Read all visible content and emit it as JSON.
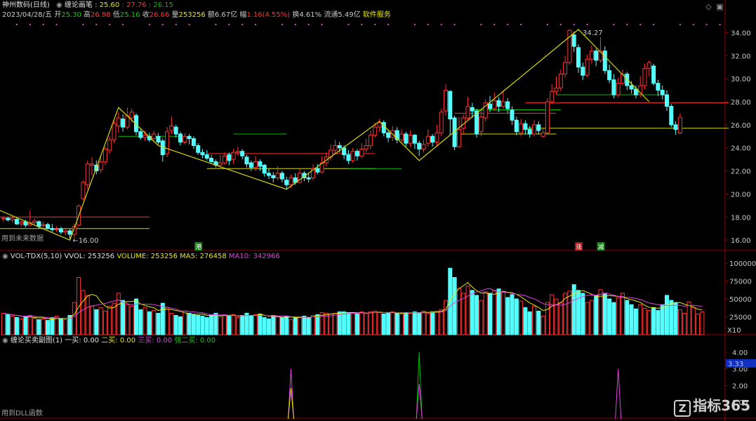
{
  "header": {
    "stock_name": "神州数码(日线)",
    "indicator_name": "缠论画笔",
    "indicator_value": ": 25.60",
    "date": "2023/04/28/五",
    "open_label": "开",
    "open": "25.30",
    "high_label": "高",
    "high": "26.98",
    "low_label": "低",
    "low": "25.16",
    "close_label": "收",
    "close": "26.66",
    "volume_label": "量",
    "volume": "253256",
    "amount_label": "额",
    "amount": "6.67亿",
    "change_label": "幅",
    "change": "1.16(4.55%)",
    "turnover_label": "换",
    "turnover": "4.61%",
    "float_label": "流通",
    "float": "5.49亿",
    "service": "软件服务",
    "extra_vals": [
      ": 27.76",
      ": 26.15"
    ]
  },
  "main_panel": {
    "no_future_text": "用到未来数据",
    "low_annot": "16.00",
    "high_annot": "34.27",
    "markers": [
      "港",
      "涨",
      "减"
    ]
  },
  "vol_panel": {
    "title": "VOL-TDX(5,10)",
    "vvol": "VVOL: 253256",
    "volume": "VOLUME: 253256",
    "ma5": "MA5: 276458",
    "ma10": "MA10: 342966",
    "unit": "X10"
  },
  "sig_panel": {
    "title": "缠论买卖副图(1)",
    "b1": "一买: 0.00",
    "b2": "二买: 0.00",
    "b3": "三买: 0.00",
    "b2s": "强二买: 0.00",
    "dll_text": "用到DLL函数",
    "current": "3.33"
  },
  "watermark": {
    "icon": "Z",
    "text": "指标365"
  },
  "colors": {
    "up": "#ff3232",
    "down": "#54ffff",
    "ma5": "#e8e800",
    "ma10": "#e040e0",
    "bi_line": "#d8d800",
    "green": "#00c000",
    "grid_red": "#8b0000"
  },
  "chart_data": [
    {
      "type": "candlestick",
      "title": "神州数码(日线)",
      "y_ticks": [
        "34.00",
        "32.00",
        "30.00",
        "28.00",
        "26.00",
        "24.00",
        "22.00",
        "20.00",
        "18.00",
        "16.00"
      ],
      "ylim": [
        15.4,
        35.0
      ],
      "candles": [
        [
          17.85,
          17.9,
          18.05,
          17.6
        ],
        [
          17.9,
          17.75,
          18.0,
          17.6
        ],
        [
          17.75,
          17.9,
          18.1,
          17.5
        ],
        [
          17.8,
          17.4,
          17.95,
          17.3
        ],
        [
          17.4,
          17.55,
          17.7,
          17.2
        ],
        [
          17.6,
          17.3,
          17.75,
          17.1
        ],
        [
          17.3,
          17.5,
          18.55,
          17.2
        ],
        [
          17.5,
          17.65,
          17.9,
          17.3
        ],
        [
          17.6,
          17.2,
          17.7,
          17.0
        ],
        [
          17.25,
          17.35,
          17.6,
          17.05
        ],
        [
          17.35,
          17.0,
          17.5,
          16.9
        ],
        [
          17.0,
          16.9,
          17.4,
          16.7
        ],
        [
          16.9,
          16.95,
          17.2,
          16.7
        ],
        [
          16.95,
          16.7,
          17.15,
          16.5
        ],
        [
          16.7,
          16.8,
          17.0,
          16.4
        ],
        [
          16.8,
          16.5,
          16.95,
          16.1
        ],
        [
          16.5,
          17.2,
          17.4,
          16.1
        ],
        [
          17.3,
          18.95,
          19.1,
          17.2
        ],
        [
          19.6,
          21.0,
          21.2,
          19.4
        ],
        [
          20.8,
          22.6,
          22.9,
          20.4
        ],
        [
          22.5,
          22.6,
          23.2,
          21.6
        ],
        [
          22.5,
          22.0,
          22.9,
          21.7
        ],
        [
          22.1,
          22.8,
          23.3,
          21.8
        ],
        [
          22.8,
          23.9,
          24.1,
          22.5
        ],
        [
          23.8,
          24.7,
          25.0,
          23.5
        ],
        [
          24.7,
          26.1,
          26.4,
          24.4
        ],
        [
          25.9,
          26.6,
          27.1,
          25.3
        ],
        [
          26.5,
          25.8,
          26.9,
          25.4
        ],
        [
          25.8,
          26.8,
          27.5,
          25.6
        ],
        [
          26.6,
          27.1,
          27.4,
          26.2
        ],
        [
          26.8,
          25.4,
          27.0,
          25.1
        ],
        [
          25.4,
          24.9,
          25.6,
          24.7
        ],
        [
          24.9,
          25.1,
          25.5,
          24.6
        ],
        [
          25.0,
          24.7,
          25.3,
          24.5
        ],
        [
          24.8,
          25.2,
          25.5,
          24.5
        ],
        [
          25.0,
          24.5,
          25.3,
          24.3
        ],
        [
          24.6,
          23.4,
          24.8,
          22.8
        ],
        [
          23.5,
          25.4,
          25.8,
          23.2
        ],
        [
          25.5,
          25.9,
          26.7,
          25.2
        ],
        [
          25.8,
          25.2,
          26.0,
          24.9
        ],
        [
          25.2,
          24.5,
          25.4,
          24.2
        ],
        [
          24.5,
          25.0,
          25.3,
          24.3
        ],
        [
          25.0,
          24.8,
          25.2,
          24.3
        ],
        [
          24.8,
          24.2,
          25.0,
          23.9
        ],
        [
          24.2,
          23.6,
          24.4,
          23.4
        ],
        [
          23.6,
          23.4,
          23.9,
          23.1
        ],
        [
          23.4,
          23.1,
          23.8,
          22.9
        ],
        [
          23.1,
          22.8,
          23.4,
          22.6
        ],
        [
          22.8,
          22.5,
          23.0,
          22.3
        ],
        [
          22.5,
          22.7,
          23.4,
          22.2
        ],
        [
          22.7,
          23.3,
          23.6,
          22.5
        ],
        [
          23.4,
          22.9,
          23.6,
          22.5
        ],
        [
          23.0,
          23.6,
          23.9,
          22.6
        ],
        [
          23.6,
          23.7,
          24.1,
          23.3
        ],
        [
          23.7,
          23.3,
          23.9,
          23.0
        ],
        [
          23.2,
          22.6,
          23.4,
          22.3
        ],
        [
          22.7,
          22.3,
          22.9,
          22.0
        ],
        [
          22.3,
          22.8,
          23.3,
          22.0
        ],
        [
          22.8,
          22.4,
          23.0,
          22.0
        ],
        [
          22.5,
          21.8,
          22.6,
          21.5
        ],
        [
          21.8,
          21.6,
          22.2,
          21.3
        ],
        [
          21.6,
          21.4,
          21.9,
          21.0
        ],
        [
          21.4,
          21.8,
          22.4,
          21.2
        ],
        [
          21.8,
          21.3,
          22.0,
          21.0
        ],
        [
          21.2,
          20.8,
          21.5,
          20.4
        ],
        [
          20.8,
          21.4,
          21.7,
          20.5
        ],
        [
          21.4,
          21.0,
          21.8,
          20.8
        ],
        [
          21.0,
          21.8,
          22.2,
          20.9
        ],
        [
          21.8,
          21.4,
          22.0,
          21.1
        ],
        [
          21.4,
          21.3,
          21.8,
          21.0
        ],
        [
          21.4,
          22.2,
          22.6,
          21.2
        ],
        [
          22.2,
          21.9,
          22.6,
          21.7
        ],
        [
          21.9,
          22.7,
          23.3,
          21.8
        ],
        [
          22.7,
          23.2,
          23.6,
          22.4
        ],
        [
          23.2,
          23.8,
          24.3,
          22.9
        ],
        [
          23.8,
          24.2,
          24.7,
          23.5
        ],
        [
          24.2,
          24.0,
          24.5,
          23.6
        ],
        [
          24.0,
          23.4,
          24.2,
          23.0
        ],
        [
          23.4,
          22.9,
          23.8,
          22.6
        ],
        [
          22.9,
          23.7,
          24.0,
          22.7
        ],
        [
          23.7,
          23.3,
          23.9,
          22.9
        ],
        [
          23.3,
          23.9,
          24.4,
          23.1
        ],
        [
          23.9,
          24.2,
          24.8,
          23.6
        ],
        [
          24.2,
          25.1,
          25.5,
          23.9
        ],
        [
          25.1,
          25.8,
          26.2,
          24.9
        ],
        [
          25.8,
          26.2,
          26.5,
          25.4
        ],
        [
          26.2,
          25.3,
          26.4,
          25.0
        ],
        [
          25.3,
          24.9,
          25.6,
          24.5
        ],
        [
          24.9,
          25.5,
          25.9,
          24.6
        ],
        [
          25.5,
          24.7,
          25.8,
          24.4
        ],
        [
          24.7,
          25.2,
          25.6,
          24.4
        ],
        [
          25.2,
          24.4,
          25.4,
          24.1
        ],
        [
          24.4,
          25.1,
          25.5,
          24.1
        ],
        [
          25.1,
          24.4,
          25.2,
          23.9
        ],
        [
          24.4,
          23.9,
          24.6,
          23.3
        ],
        [
          23.9,
          24.3,
          24.7,
          23.6
        ],
        [
          24.4,
          25.0,
          25.6,
          24.1
        ],
        [
          25.0,
          24.5,
          25.2,
          24.1
        ],
        [
          24.5,
          25.3,
          26.0,
          24.2
        ],
        [
          25.3,
          27.1,
          27.4,
          25.0
        ],
        [
          27.2,
          29.0,
          29.5,
          26.8
        ],
        [
          28.9,
          26.5,
          29.0,
          25.1
        ],
        [
          26.6,
          24.1,
          26.8,
          23.8
        ],
        [
          24.1,
          25.6,
          26.7,
          24.0
        ],
        [
          25.7,
          26.6,
          26.9,
          25.2
        ],
        [
          26.6,
          27.6,
          28.4,
          26.4
        ],
        [
          27.5,
          27.2,
          27.9,
          26.6
        ],
        [
          27.2,
          25.2,
          27.4,
          24.9
        ],
        [
          25.4,
          26.7,
          27.3,
          25.0
        ],
        [
          26.6,
          27.9,
          28.2,
          26.3
        ],
        [
          27.8,
          27.4,
          28.5,
          27.1
        ],
        [
          27.4,
          28.1,
          28.8,
          27.2
        ],
        [
          28.1,
          27.6,
          28.4,
          27.1
        ],
        [
          27.6,
          28.0,
          29.0,
          27.4
        ],
        [
          28.0,
          27.4,
          28.3,
          27.0
        ],
        [
          27.3,
          26.4,
          27.6,
          26.0
        ],
        [
          26.4,
          25.4,
          26.7,
          25.1
        ],
        [
          25.3,
          26.1,
          26.5,
          25.0
        ],
        [
          26.1,
          25.6,
          26.4,
          25.2
        ],
        [
          25.6,
          25.2,
          25.9,
          24.9
        ],
        [
          25.2,
          26.0,
          26.4,
          25.0
        ],
        [
          26.0,
          25.5,
          26.3,
          25.2
        ],
        [
          25.0,
          25.3,
          25.7,
          24.9
        ],
        [
          25.3,
          28.0,
          28.3,
          25.2
        ],
        [
          28.0,
          28.9,
          29.5,
          27.8
        ],
        [
          28.9,
          29.2,
          30.2,
          28.6
        ],
        [
          29.2,
          30.4,
          30.8,
          28.9
        ],
        [
          30.4,
          31.4,
          32.0,
          30.1
        ],
        [
          31.4,
          34.2,
          34.27,
          31.2
        ],
        [
          33.8,
          32.8,
          34.1,
          32.3
        ],
        [
          32.7,
          31.0,
          33.0,
          30.5
        ],
        [
          31.0,
          30.3,
          31.4,
          29.9
        ],
        [
          30.3,
          31.7,
          32.1,
          30.1
        ],
        [
          31.7,
          32.4,
          32.9,
          31.3
        ],
        [
          32.4,
          31.6,
          32.6,
          31.1
        ],
        [
          31.6,
          32.4,
          33.6,
          31.4
        ],
        [
          32.4,
          30.7,
          32.8,
          30.4
        ],
        [
          30.7,
          29.9,
          31.2,
          29.6
        ],
        [
          29.9,
          28.6,
          30.4,
          28.3
        ],
        [
          28.6,
          29.6,
          30.1,
          28.4
        ],
        [
          29.6,
          30.4,
          30.8,
          29.4
        ],
        [
          30.4,
          29.4,
          30.6,
          29.0
        ],
        [
          29.4,
          29.1,
          29.8,
          28.7
        ],
        [
          29.1,
          28.6,
          29.4,
          28.3
        ],
        [
          28.6,
          29.4,
          30.2,
          28.4
        ],
        [
          29.4,
          30.9,
          31.3,
          29.1
        ],
        [
          30.9,
          31.4,
          31.6,
          30.2
        ],
        [
          31.1,
          29.6,
          31.3,
          29.4
        ],
        [
          29.6,
          29.0,
          29.9,
          28.5
        ],
        [
          29.0,
          28.6,
          29.4,
          28.2
        ],
        [
          28.6,
          27.6,
          29.0,
          27.2
        ],
        [
          27.6,
          26.0,
          27.8,
          25.8
        ],
        [
          26.0,
          25.6,
          26.3,
          25.16
        ],
        [
          25.3,
          26.66,
          26.98,
          25.16
        ]
      ],
      "bi_points": [
        {
          "i": -1,
          "price": 18.6
        },
        {
          "i": 15,
          "price": 16.0
        },
        {
          "i": 26,
          "price": 27.5
        },
        {
          "i": 35,
          "price": 24.2
        },
        {
          "i": 64,
          "price": 20.4
        },
        {
          "i": 85,
          "price": 26.3
        },
        {
          "i": 94,
          "price": 22.9
        },
        {
          "i": 130,
          "price": 34.27
        },
        {
          "i": 146,
          "price": 28.0
        }
      ],
      "center_boxes": [
        {
          "i0": -1,
          "i1": 33,
          "top": 18.0,
          "bot": 17.0,
          "color": "yellow"
        },
        {
          "i0": 46,
          "i1": 84,
          "top": 23.5,
          "bot": 22.2,
          "color": "yellow"
        },
        {
          "i0": 102,
          "i1": 125,
          "top": 27.0,
          "bot": 25.2,
          "color": "yellow"
        },
        {
          "i0": 118,
          "i1": 164,
          "top": 27.9,
          "bot": 25.7,
          "color": "yellow"
        }
      ]
    },
    {
      "type": "bar",
      "title": "VOL-TDX(5,10)",
      "y_ticks": [
        "100000",
        "75000",
        "50000",
        "25000"
      ],
      "ylim": [
        0,
        105000
      ],
      "volumes": [
        30000,
        28000,
        26000,
        24000,
        22000,
        25000,
        27000,
        23000,
        21000,
        22000,
        20000,
        24000,
        26000,
        22000,
        21000,
        27000,
        45000,
        80000,
        62000,
        55000,
        40000,
        35000,
        38000,
        33000,
        40000,
        44000,
        58000,
        48000,
        42000,
        40000,
        50000,
        35000,
        38000,
        32000,
        34000,
        30000,
        44000,
        38000,
        30000,
        27000,
        25000,
        33000,
        30000,
        28000,
        27000,
        26000,
        24000,
        28000,
        30000,
        25000,
        27000,
        26000,
        28000,
        24000,
        27000,
        30000,
        26000,
        28000,
        29000,
        24000,
        22000,
        27000,
        25000,
        24000,
        26000,
        21000,
        24000,
        25000,
        26000,
        24000,
        27000,
        28000,
        31000,
        30000,
        29000,
        30000,
        32000,
        32000,
        31000,
        30000,
        29000,
        32000,
        30000,
        32000,
        33000,
        31000,
        29000,
        30000,
        32000,
        30000,
        29000,
        31000,
        30000,
        32000,
        31000,
        33000,
        30000,
        32000,
        33000,
        35000,
        48000,
        93000,
        80000,
        65000,
        58000,
        68000,
        62000,
        55000,
        48000,
        60000,
        58000,
        62000,
        64000,
        60000,
        52000,
        56000,
        50000,
        47000,
        38000,
        32000,
        40000,
        33000,
        26000,
        45000,
        56000,
        50000,
        45000,
        58000,
        61000,
        70000,
        62000,
        58000,
        45000,
        48000,
        55000,
        63000,
        58000,
        50000,
        45000,
        52000,
        58000,
        48000,
        42000,
        36000,
        42000,
        37000,
        34000,
        38000,
        34000,
        42000,
        55000,
        48000,
        45000,
        35000,
        30000,
        46000,
        38000,
        29000,
        32000
      ]
    },
    {
      "type": "line",
      "title": "缠论买卖副图(1)",
      "y_ticks": [
        "4.00",
        "3.00",
        "2.00",
        "1.00"
      ],
      "ylim": [
        0,
        4.5
      ],
      "spikes": [
        {
          "i": 65,
          "value": 3.0,
          "color": "#e040e0"
        },
        {
          "i": 65,
          "value": 1.85,
          "color": "#e8e800"
        },
        {
          "i": 94,
          "value": 4.0,
          "color": "#00c000"
        },
        {
          "i": 94,
          "value": 2.1,
          "color": "#e040e0"
        },
        {
          "i": 139,
          "value": 3.0,
          "color": "#e040e0"
        }
      ]
    }
  ]
}
